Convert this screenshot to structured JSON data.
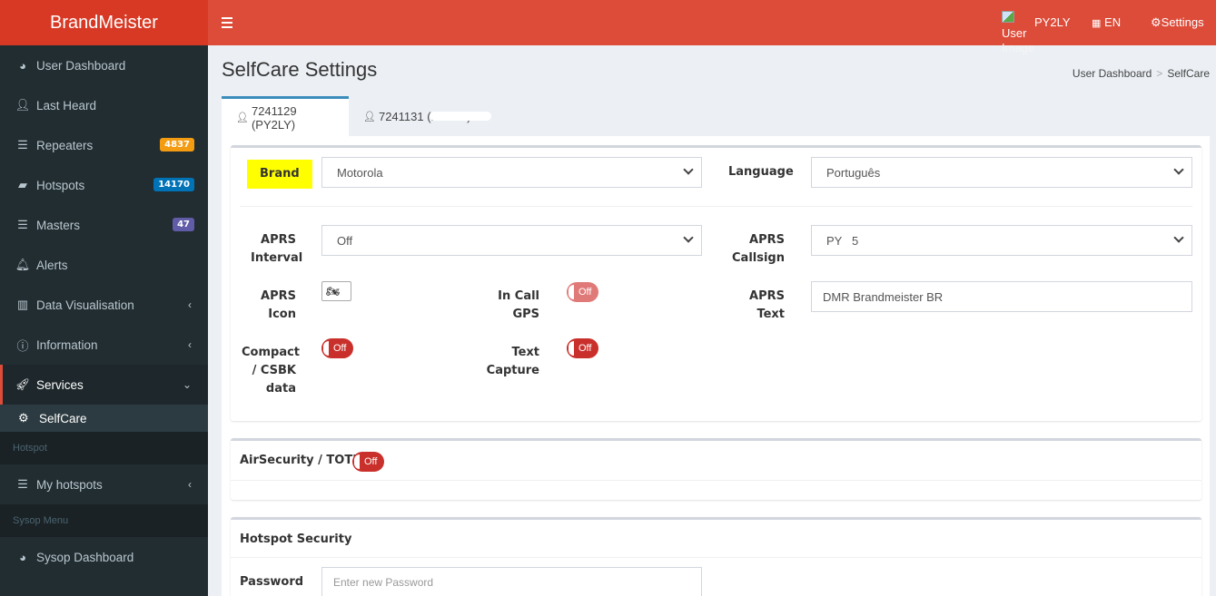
{
  "brand": {
    "name": "BrandMeister"
  },
  "sidebar": {
    "items": [
      {
        "label": "User Dashboard",
        "icon": "dashboard-icon"
      },
      {
        "label": "Last Heard",
        "icon": "user-icon"
      },
      {
        "label": "Repeaters",
        "icon": "server-icon",
        "badge": "4837",
        "badge_color": "#f39c12"
      },
      {
        "label": "Hotspots",
        "icon": "briefcase-icon",
        "badge": "14170",
        "badge_color": "#0073b7"
      },
      {
        "label": "Masters",
        "icon": "server-icon",
        "badge": "47",
        "badge_color": "#605ca8"
      },
      {
        "label": "Alerts",
        "icon": "bell-icon"
      },
      {
        "label": "Data Visualisation",
        "icon": "bar-chart-icon"
      },
      {
        "label": "Information",
        "icon": "info-icon"
      },
      {
        "label": "Services",
        "icon": "rocket-icon"
      }
    ],
    "sub_items": [
      {
        "label": "SelfCare",
        "icon": "gear-icon"
      }
    ],
    "header_hotspot": "Hotspot",
    "my_hotspots": "My hotspots",
    "header_sysop": "Sysop Menu",
    "sysop_dashboard": "Sysop Dashboard"
  },
  "topbar": {
    "user_image_alt_1": "User",
    "user_image_alt_2": "Image",
    "callsign": "PY2LY",
    "language": "EN",
    "settings": "Settings"
  },
  "page": {
    "title": "SelfCare Settings",
    "breadcrumb": [
      "User Dashboard",
      "SelfCare"
    ]
  },
  "tabs": [
    {
      "label": "7241129 (PY2LY)",
      "active": true
    },
    {
      "label": "7241131 (PY2LY)",
      "active": false
    }
  ],
  "settings": {
    "brand_label": "Brand",
    "brand_value": "Motorola",
    "language_label": "Language",
    "language_value": "Português",
    "aprs_interval_label_1": "APRS",
    "aprs_interval_label_2": "Interval",
    "aprs_interval_value": "Off",
    "aprs_callsign_label_1": "APRS",
    "aprs_callsign_label_2": "Callsign",
    "aprs_callsign_value": "PY   5",
    "aprs_icon_label_1": "APRS",
    "aprs_icon_label_2": "Icon",
    "aprs_icon_value": "motorcycle-icon",
    "in_call_gps_label_1": "In Call",
    "in_call_gps_label_2": "GPS",
    "in_call_gps_value": "Off",
    "aprs_text_label_1": "APRS",
    "aprs_text_label_2": "Text",
    "aprs_text_value": "DMR Brandmeister BR",
    "compact_label_1": "Compact",
    "compact_label_2": "/ CSBK",
    "compact_label_3": "data",
    "compact_value": "Off",
    "text_capture_label_1": "Text",
    "text_capture_label_2": "Capture",
    "text_capture_value": "Off"
  },
  "airsecurity": {
    "label": "AirSecurity / TOTP",
    "value": "Off"
  },
  "hotspot_security": {
    "title": "Hotspot Security",
    "password_label": "Password",
    "password_placeholder": "Enter new Password"
  }
}
